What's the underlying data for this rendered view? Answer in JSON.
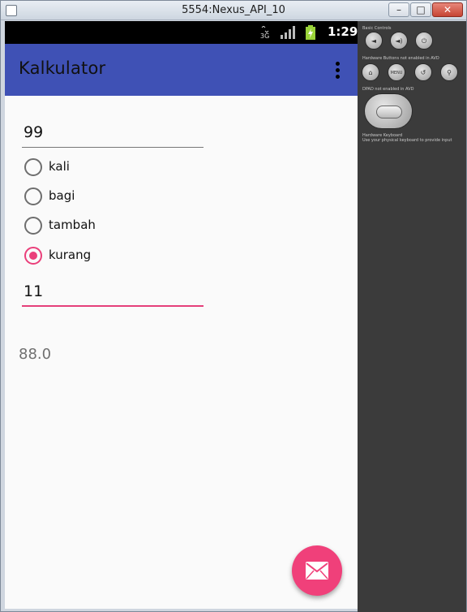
{
  "window": {
    "title": "5554:Nexus_API_10"
  },
  "statusbar": {
    "time": "1:29",
    "network": "3G"
  },
  "appbar": {
    "title": "Kalkulator"
  },
  "form": {
    "first_number": "99",
    "operations": [
      {
        "label": "kali",
        "checked": false
      },
      {
        "label": "bagi",
        "checked": false
      },
      {
        "label": "tambah",
        "checked": false
      },
      {
        "label": "kurang",
        "checked": true
      }
    ],
    "second_number": "11",
    "result": "88.0"
  },
  "colors": {
    "appbar": "#3f51b5",
    "accent": "#ea3f7a",
    "fab": "#f0407a"
  },
  "emulator_panel": {
    "basic_controls_label": "Basic Controls",
    "hardware_buttons_label": "Hardware Buttons not enabled in AVD",
    "dpad_label": "DPAD not enabled in AVD",
    "keyboard_label": "Hardware Keyboard",
    "keyboard_hint": "Use your physical keyboard to provide input",
    "menu_label": "MENU"
  }
}
